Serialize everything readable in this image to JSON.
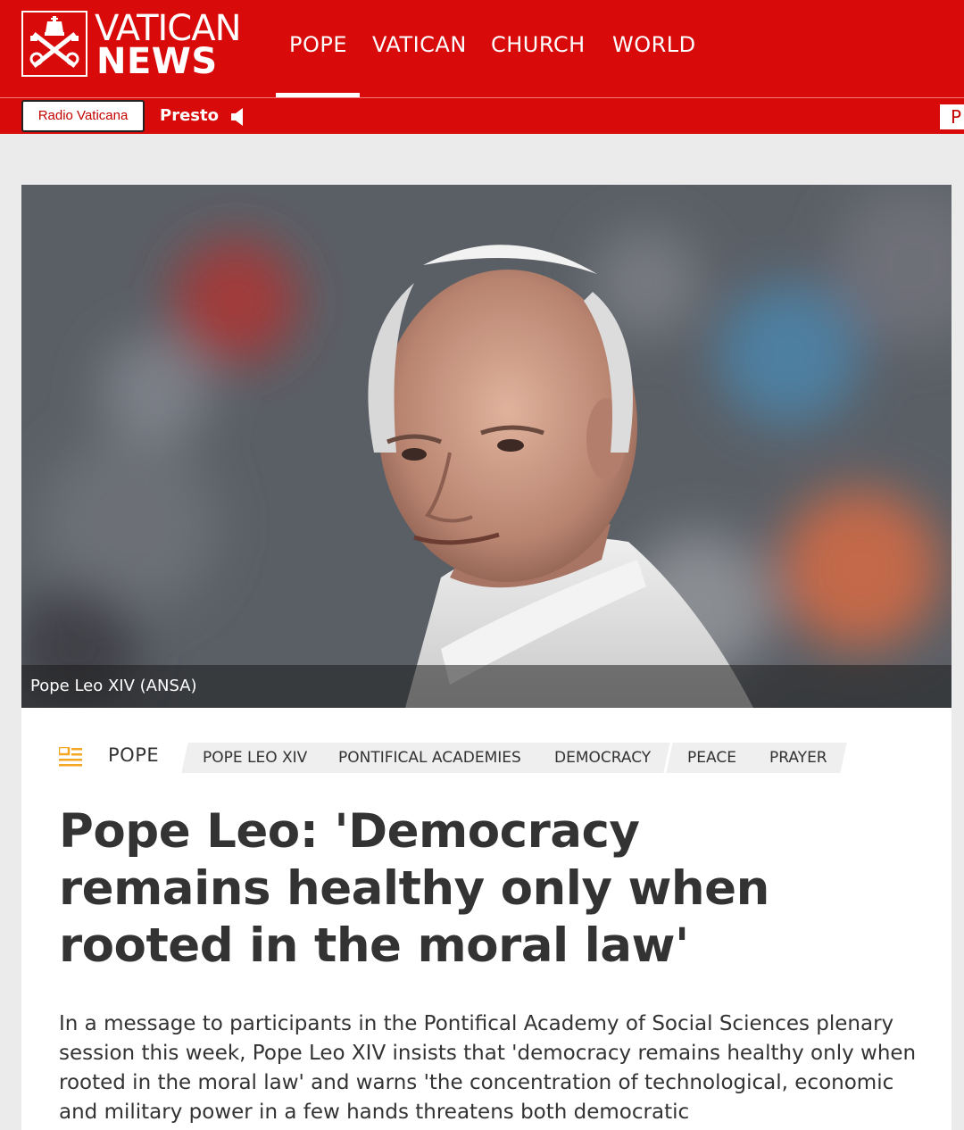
{
  "header": {
    "brand_top": "VATICAN",
    "brand_bottom": "NEWS",
    "nav": [
      {
        "label": "POPE"
      },
      {
        "label": "VATICAN"
      },
      {
        "label": "CHURCH"
      },
      {
        "label": "WORLD"
      }
    ],
    "active_nav": "POPE"
  },
  "subbar": {
    "radio_label": "Radio Vaticana",
    "presto_label": "Presto",
    "edge_text": "P"
  },
  "hero": {
    "caption": "Pope Leo XIV  (ANSA)"
  },
  "article": {
    "category": "POPE",
    "tags": [
      "POPE LEO XIV",
      "PONTIFICAL ACADEMIES",
      "DEMOCRACY",
      "PEACE",
      "PRAYER"
    ],
    "title": "Pope Leo: 'Democracy remains healthy only when rooted in the moral law'",
    "lead": "In a message to participants in the Pontifical Academy of Social Sciences plenary session this week, Pope Leo XIV insists that 'democracy remains healthy only when rooted in the moral law' and warns 'the concentration of technological, economic and military power in a few hands threatens both democratic"
  },
  "colors": {
    "brand_red": "#d80a0a",
    "category_icon": "#f5a623"
  }
}
